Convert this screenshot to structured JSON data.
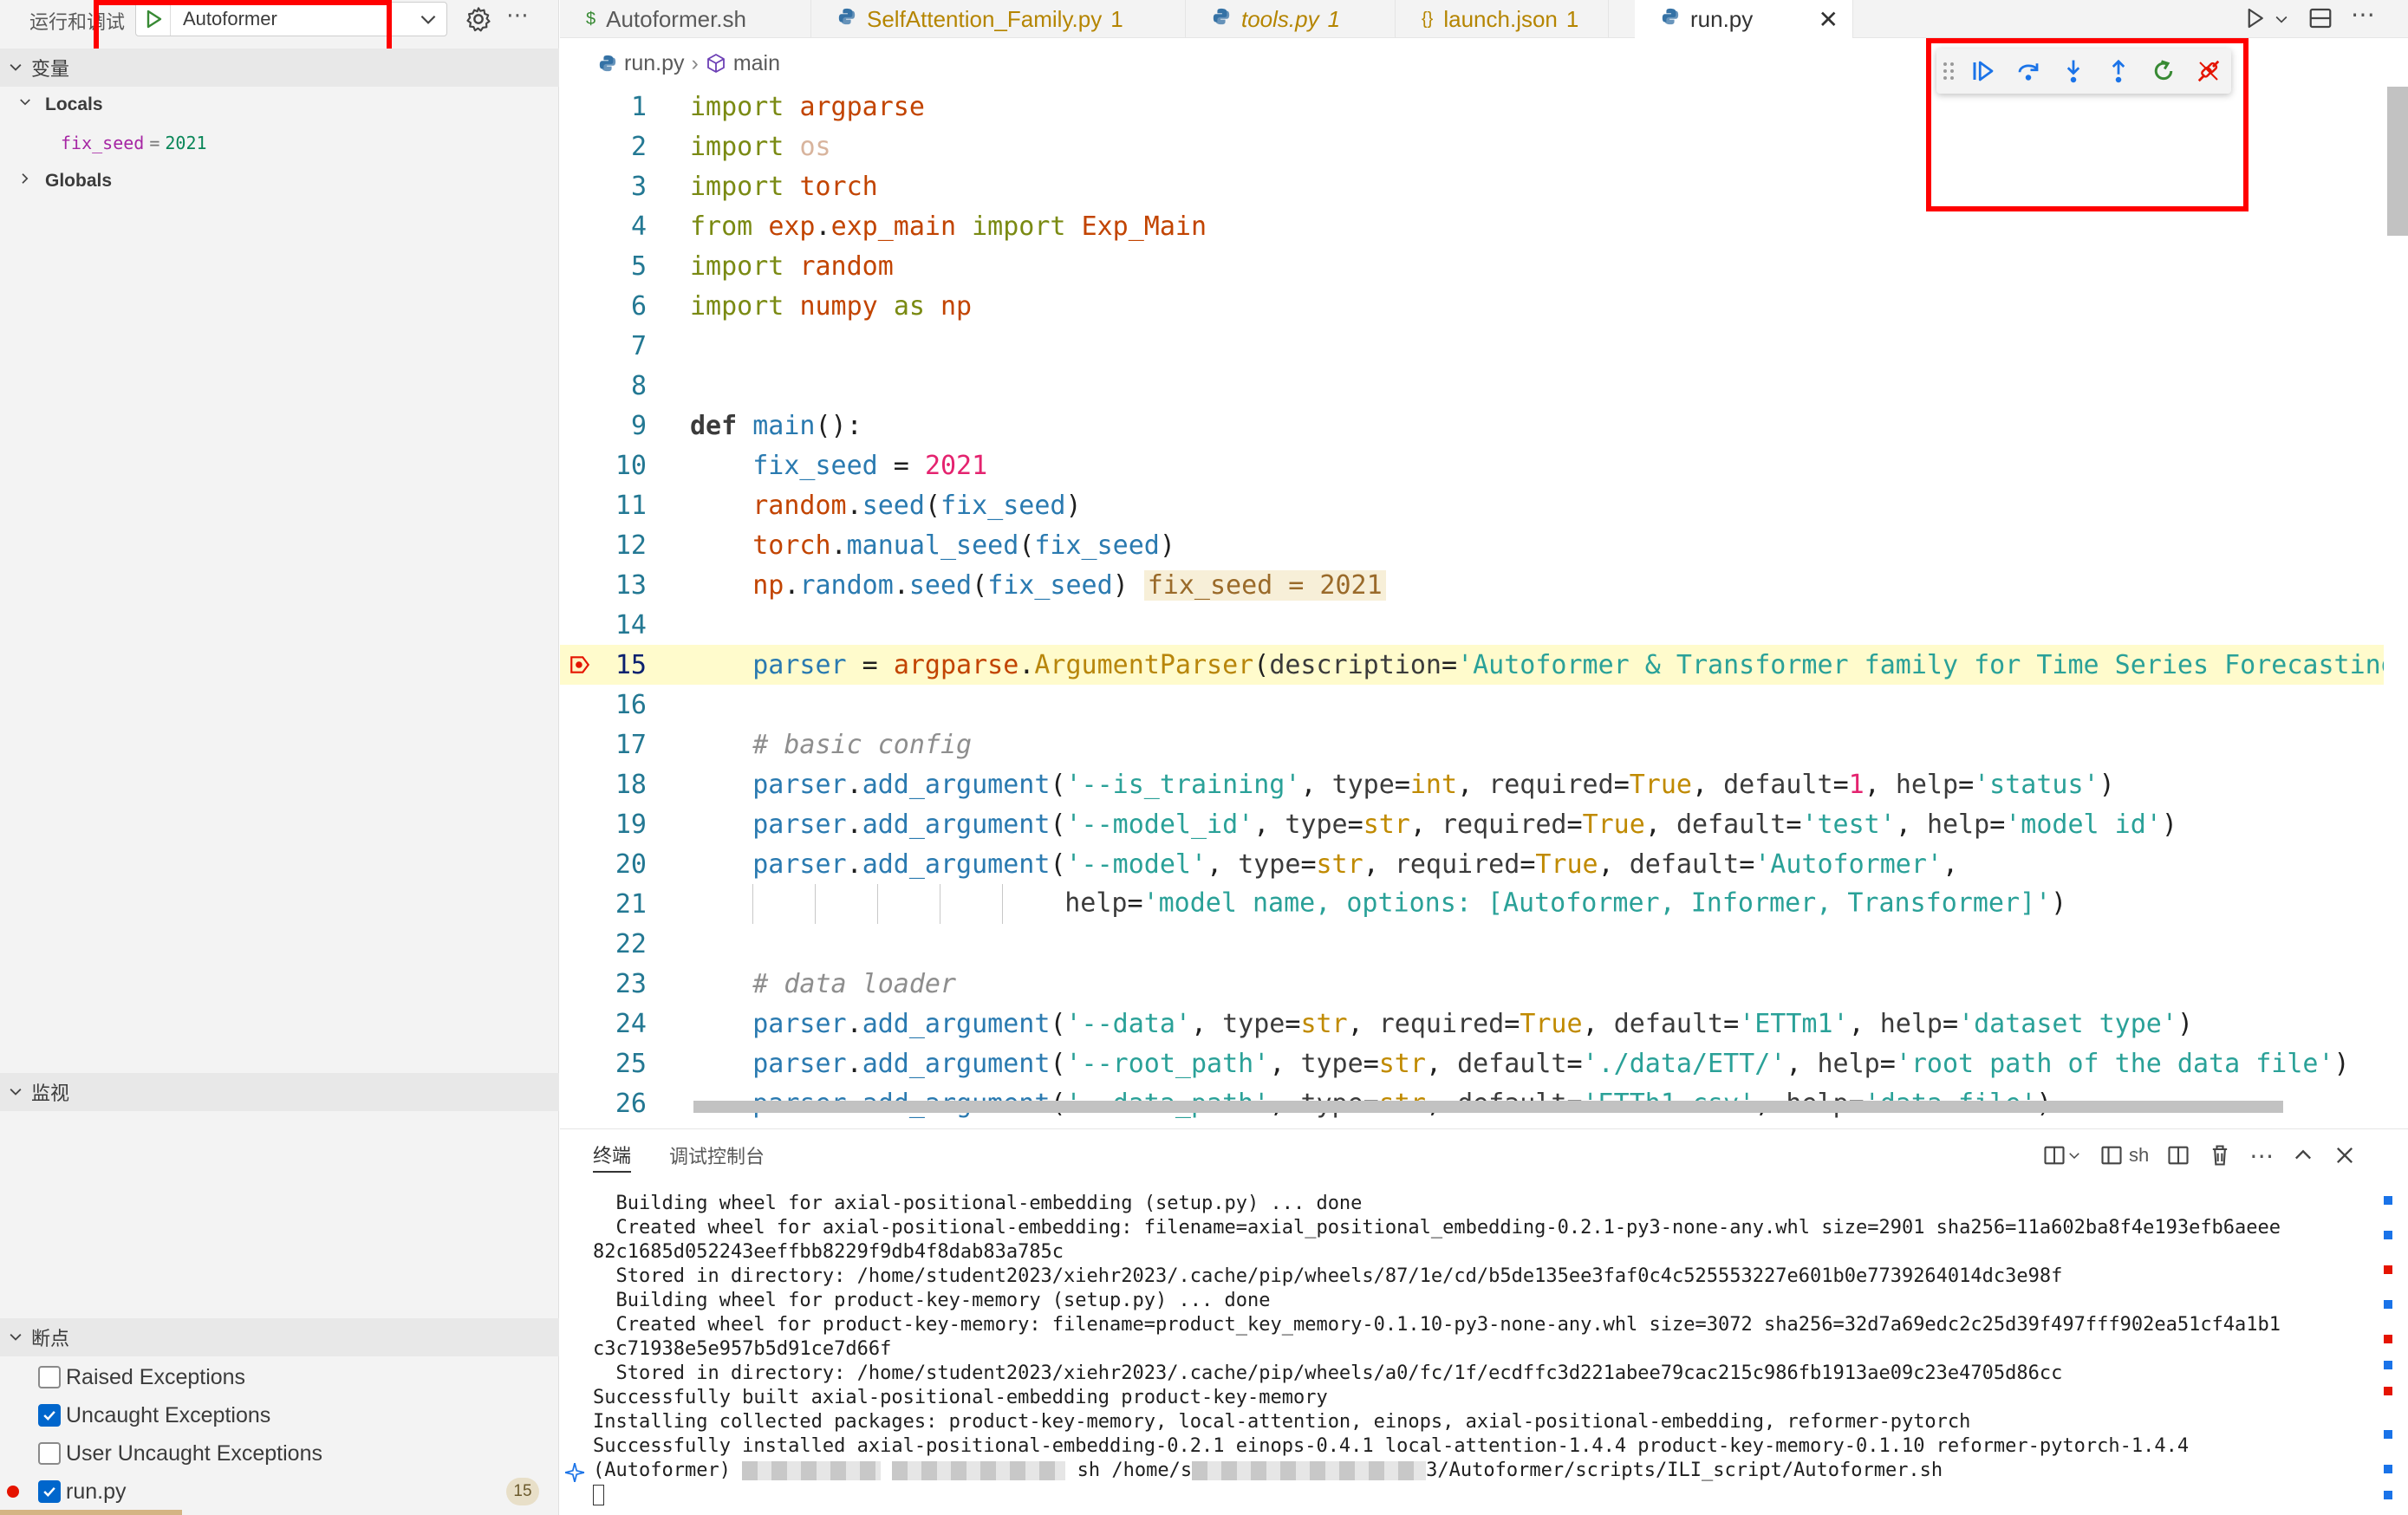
{
  "sidebar": {
    "title": "运行和调试",
    "config_name": "Autoformer",
    "sections": {
      "variables": "变量",
      "watch": "监视",
      "breakpoints": "断点"
    },
    "locals_label": "Locals",
    "globals_label": "Globals",
    "local_var": {
      "name": "fix_seed",
      "eq": "=",
      "value": "2021"
    },
    "breakpoints": [
      {
        "label": "Raised Exceptions",
        "checked": false
      },
      {
        "label": "Uncaught Exceptions",
        "checked": true
      },
      {
        "label": "User Uncaught Exceptions",
        "checked": false
      },
      {
        "label": "run.py",
        "checked": true,
        "count": "15"
      }
    ]
  },
  "tabs": [
    {
      "icon": "$",
      "label": "Autoformer.sh",
      "dirty": ""
    },
    {
      "icon": "python-icon",
      "label": "SelfAttention_Family.py",
      "dirty": "1"
    },
    {
      "icon": "python-icon",
      "label": "tools.py",
      "dirty": "1"
    },
    {
      "icon": "{}",
      "label": "launch.json",
      "dirty": "1"
    },
    {
      "icon": "python-icon",
      "label": "run.py",
      "dirty": "",
      "active": true,
      "close": "✕"
    }
  ],
  "breadcrumb": {
    "file": "run.py",
    "sep": "›",
    "symbol": "main"
  },
  "editor": {
    "current_line": 15,
    "inline_value": "fix_seed = 2021",
    "line_numbers": [
      "1",
      "2",
      "3",
      "4",
      "5",
      "6",
      "7",
      "8",
      "9",
      "10",
      "11",
      "12",
      "13",
      "14",
      "15",
      "16",
      "17",
      "18",
      "19",
      "20",
      "21",
      "22",
      "23",
      "24",
      "25",
      "26"
    ]
  },
  "panel": {
    "tabs": [
      "终端",
      "调试控制台"
    ],
    "shell_label": "sh",
    "terminal_lines": [
      "  Building wheel for axial-positional-embedding (setup.py) ... done",
      "  Created wheel for axial-positional-embedding: filename=axial_positional_embedding-0.2.1-py3-none-any.whl size=2901 sha256=11a602ba8f4e193efb6aeee",
      "82c1685d052243eeffbb8229f9db4f8dab83a785c",
      "  Stored in directory: /home/student2023/xiehr2023/.cache/pip/wheels/87/1e/cd/b5de135ee3faf0c4c525553227e601b0e7739264014dc3e98f",
      "  Building wheel for product-key-memory (setup.py) ... done",
      "  Created wheel for product-key-memory: filename=product_key_memory-0.1.10-py3-none-any.whl size=3072 sha256=32d7a69edc2c25d39f497fff902ea51cf4a1b1",
      "c3c71938e5e957b5d91ce7d66f",
      "  Stored in directory: /home/student2023/xiehr2023/.cache/pip/wheels/a0/fc/1f/ecdffc3d221abee79cac215c986fb1913ae09c23e4705d86cc",
      "Successfully built axial-positional-embedding product-key-memory",
      "Installing collected packages: product-key-memory, local-attention, einops, axial-positional-embedding, reformer-pytorch",
      "Successfully installed axial-positional-embedding-0.2.1 einops-0.4.1 local-attention-1.4.4 product-key-memory-0.1.10 reformer-pytorch-1.4.4"
    ],
    "prompt_prefix": "(Autoformer) ",
    "prompt_cmd": " sh /home/s",
    "prompt_path": "3/Autoformer/scripts/ILI_script/Autoformer.sh"
  },
  "colors": {
    "highlight_box": "#ff0000",
    "debug_blue": "#1a73e8",
    "debug_green": "#388a34",
    "debug_red": "#e51400",
    "current_line_bg": "#fffbcc"
  }
}
